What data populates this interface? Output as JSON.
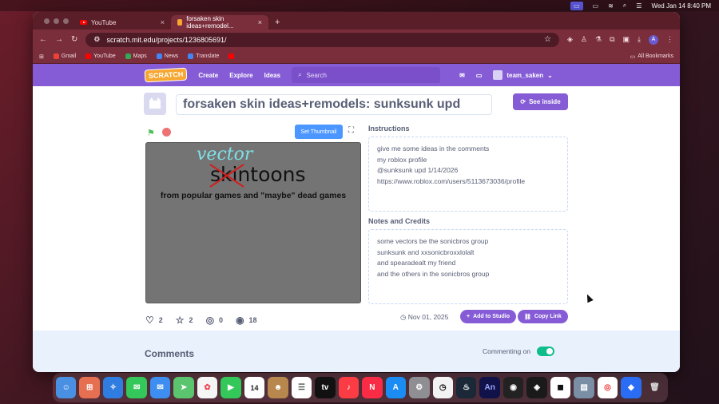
{
  "menubar": {
    "datetime": "Wed Jan 14  8:40 PM"
  },
  "browser": {
    "tabs": [
      {
        "label": "YouTube"
      },
      {
        "label": "forsaken skin ideas+remodel..."
      }
    ],
    "url": "scratch.mit.edu/projects/1236805691/",
    "bookmarks": [
      "Gmail",
      "YouTube",
      "Maps",
      "News",
      "Translate"
    ],
    "all_bookmarks": "All Bookmarks",
    "profile_initial": "A"
  },
  "nav": {
    "logo": "SCRATCH",
    "create": "Create",
    "explore": "Explore",
    "ideas": "Ideas",
    "search_placeholder": "Search",
    "username": "team_saken"
  },
  "project": {
    "title": "forsaken skin ideas+remodels: sunksunk upd",
    "see_inside": "See inside",
    "set_thumbnail": "Set Thumbnail",
    "stage": {
      "word_vector": "vector",
      "word_skin": "skintoons",
      "subtitle": "from popular games and \"maybe\" dead games"
    },
    "instructions_label": "Instructions",
    "instructions": [
      "give me some ideas in the comments",
      "my roblox profile",
      "@sunksunk upd 1/14/2026",
      "https://www.roblox.com/users/5113673036/profile"
    ],
    "notes_label": "Notes and Credits",
    "notes": [
      "some vectors be the sonicbros group",
      "sunksunk and xxsonicbroxxlolalt",
      "and spearadealt my friend",
      "and the others in the sonicbros group"
    ],
    "stats": {
      "loves": "2",
      "favorites": "2",
      "remixes": "0",
      "views": "18"
    },
    "date": "Nov 01, 2025",
    "add_to_studio": "Add to Studio",
    "copy_link": "Copy Link"
  },
  "comments": {
    "title": "Comments",
    "commenting": "Commenting on"
  },
  "colors": {
    "scratch_purple": "#855cd6",
    "blue": "#4c97ff",
    "green": "#0fbd8c"
  }
}
